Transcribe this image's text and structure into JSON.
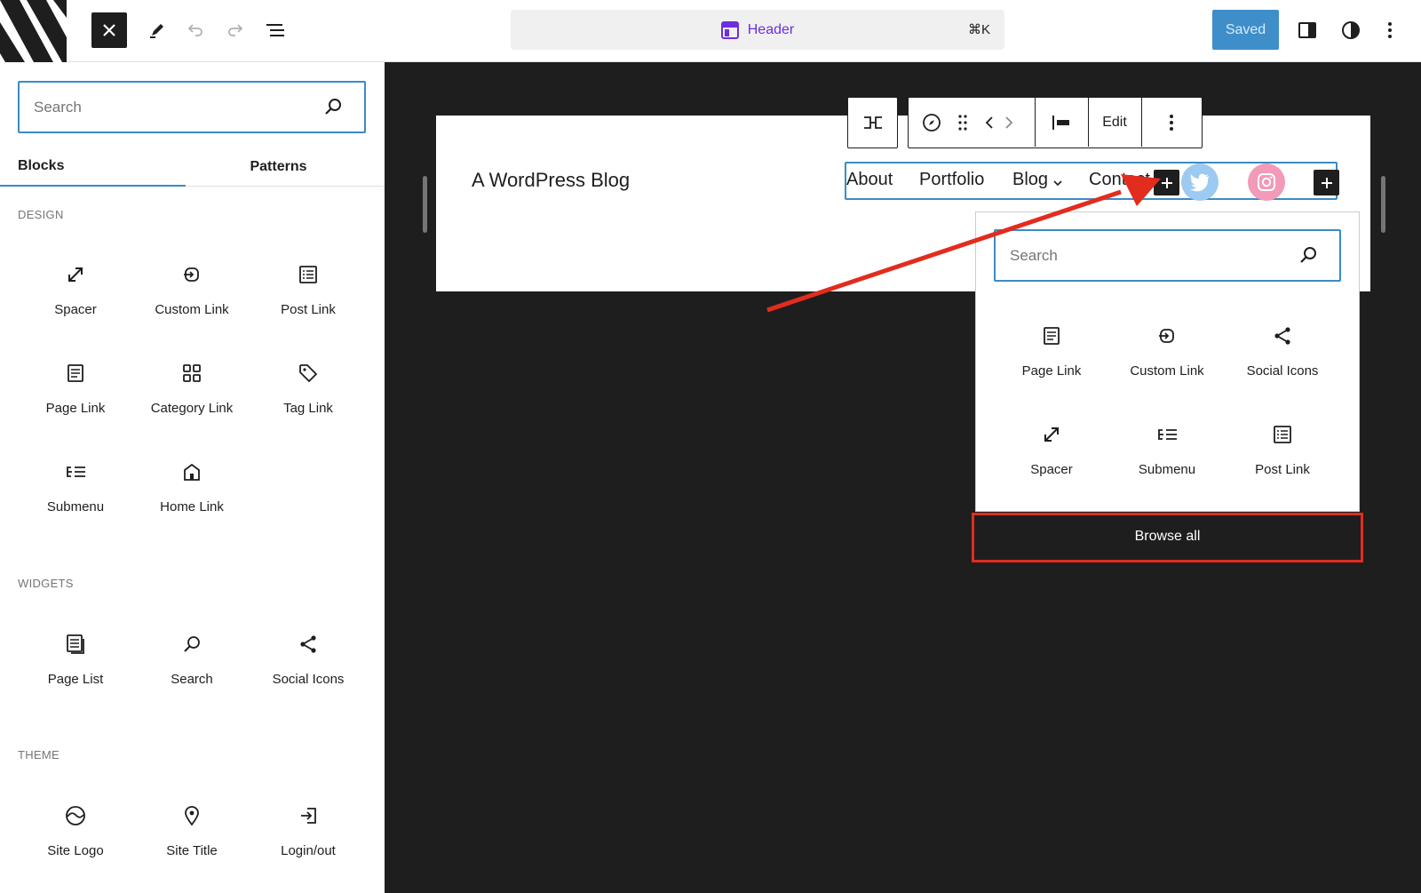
{
  "topbar": {
    "close_icon": "close-icon",
    "title": "Header",
    "shortcut": "⌘K",
    "saved_label": "Saved"
  },
  "sidebar": {
    "search_placeholder": "Search",
    "tabs": [
      {
        "label": "Blocks",
        "active": true
      },
      {
        "label": "Patterns",
        "active": false
      }
    ],
    "sections": [
      {
        "title": "DESIGN",
        "items": [
          "Spacer",
          "Custom Link",
          "Post Link",
          "Page Link",
          "Category Link",
          "Tag Link",
          "Submenu",
          "Home Link"
        ]
      },
      {
        "title": "WIDGETS",
        "items": [
          "Page List",
          "Search",
          "Social Icons"
        ]
      },
      {
        "title": "THEME",
        "items": [
          "Site Logo",
          "Site Title",
          "Login/out"
        ]
      }
    ]
  },
  "canvas": {
    "site_name": "A WordPress Blog",
    "nav_links": [
      "About",
      "Portfolio",
      "Blog",
      "Contact"
    ],
    "toolbar_edit_label": "Edit"
  },
  "popover": {
    "search_placeholder": "Search",
    "items": [
      "Page Link",
      "Custom Link",
      "Social Icons",
      "Spacer",
      "Submenu",
      "Post Link"
    ],
    "browse_all": "Browse all"
  },
  "colors": {
    "accent": "#3b8bc6",
    "title_purple": "#6d2ee0",
    "saved_bg": "#3e8fc9",
    "annotation_red": "#e22c1e",
    "twitter": "#9ccaf0",
    "instagram": "#f29ab8"
  }
}
